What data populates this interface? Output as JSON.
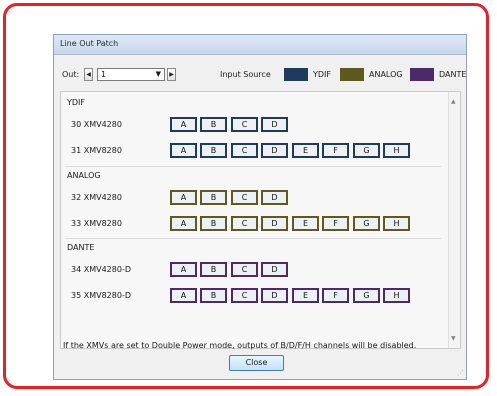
{
  "dialog": {
    "title": "Line Out Patch",
    "close_label": "Close",
    "footer_note": "If the XMVs are set to Double Power mode, outputs of  B/D/F/H channels will be disabled."
  },
  "toolbar": {
    "out_label": "Out:",
    "out_value": "1",
    "input_source_label": "Input Source"
  },
  "legend": [
    {
      "label": "YDIF",
      "color": "#1f3b5c"
    },
    {
      "label": "ANALOG",
      "color": "#5a5a1e"
    },
    {
      "label": "DANTE",
      "color": "#4a2a6a"
    }
  ],
  "groups": [
    {
      "title": "YDIF",
      "kind": "ydif",
      "rows": [
        {
          "label": "30 XMV4280",
          "buttons": [
            "A",
            "B",
            "C",
            "D"
          ]
        },
        {
          "label": "31 XMV8280",
          "buttons": [
            "A",
            "B",
            "C",
            "D",
            "E",
            "F",
            "G",
            "H"
          ]
        }
      ]
    },
    {
      "title": "ANALOG",
      "kind": "analog",
      "rows": [
        {
          "label": "32 XMV4280",
          "buttons": [
            "A",
            "B",
            "C",
            "D"
          ]
        },
        {
          "label": "33 XMV8280",
          "buttons": [
            "A",
            "B",
            "C",
            "D",
            "E",
            "F",
            "G",
            "H"
          ]
        }
      ]
    },
    {
      "title": "DANTE",
      "kind": "dante",
      "rows": [
        {
          "label": "34 XMV4280-D",
          "buttons": [
            "A",
            "B",
            "C",
            "D"
          ]
        },
        {
          "label": "35 XMV8280-D",
          "buttons": [
            "A",
            "B",
            "C",
            "D",
            "E",
            "F",
            "G",
            "H"
          ]
        }
      ]
    }
  ]
}
